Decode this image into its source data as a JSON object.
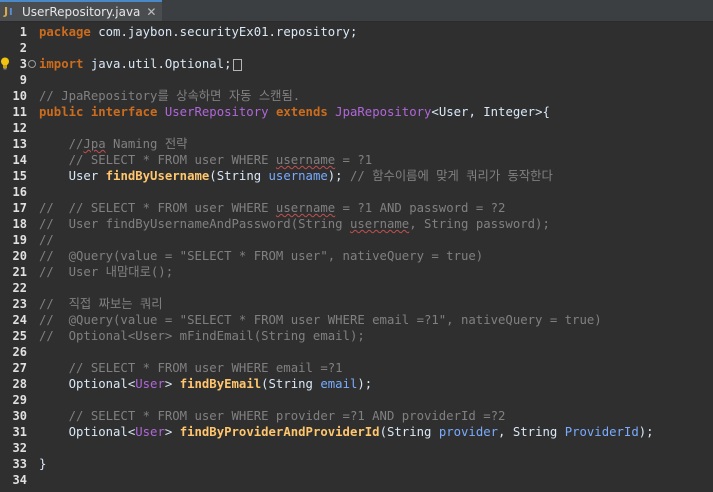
{
  "tab": {
    "filename": "UserRepository.java",
    "close_glyph": "✕"
  },
  "colors": {
    "background": "#2f2f2f",
    "keyword": "#cc6c1d",
    "type": "#b166da",
    "method": "#ffc66d",
    "parameter": "#79abff",
    "comment": "#808080",
    "plain": "#d9e8f7"
  },
  "lines": [
    {
      "n": "1",
      "segs": [
        {
          "c": "kw",
          "t": "package"
        },
        {
          "c": "pl",
          "t": " com.jaybon.securityEx01.repository;"
        }
      ]
    },
    {
      "n": "2",
      "segs": []
    },
    {
      "n": "3",
      "segs": [
        {
          "c": "kw",
          "t": "import"
        },
        {
          "c": "pl",
          "t": " java.util.Optional;"
        }
      ]
    },
    {
      "n": "9",
      "segs": []
    },
    {
      "n": "10",
      "segs": [
        {
          "c": "cm",
          "t": "// JpaRepository를 상속하면 자동 스캔됨."
        }
      ]
    },
    {
      "n": "11",
      "segs": [
        {
          "c": "kw",
          "t": "public"
        },
        {
          "c": "pl",
          "t": " "
        },
        {
          "c": "kw",
          "t": "interface"
        },
        {
          "c": "pl",
          "t": " "
        },
        {
          "c": "ty",
          "t": "UserRepository"
        },
        {
          "c": "pl",
          "t": " "
        },
        {
          "c": "kw",
          "t": "extends"
        },
        {
          "c": "pl",
          "t": " "
        },
        {
          "c": "ty",
          "t": "JpaRepository"
        },
        {
          "c": "pl",
          "t": "<User, Integer>{"
        }
      ]
    },
    {
      "n": "12",
      "segs": []
    },
    {
      "n": "13",
      "segs": [
        {
          "c": "cm",
          "t": "    //"
        },
        {
          "c": "cmw",
          "t": "Jpa"
        },
        {
          "c": "cm",
          "t": " Naming 전략"
        }
      ]
    },
    {
      "n": "14",
      "segs": [
        {
          "c": "cm",
          "t": "    // SELECT * FROM user WHERE "
        },
        {
          "c": "cmw",
          "t": "username"
        },
        {
          "c": "cm",
          "t": " = ?1"
        }
      ]
    },
    {
      "n": "15",
      "segs": [
        {
          "c": "pl",
          "t": "    User "
        },
        {
          "c": "fn",
          "t": "findByUsername"
        },
        {
          "c": "pl",
          "t": "(String "
        },
        {
          "c": "pa",
          "t": "username"
        },
        {
          "c": "pl",
          "t": "); "
        },
        {
          "c": "cm",
          "t": "// 함수이름에 맞게 쿼리가 동작한다"
        }
      ]
    },
    {
      "n": "16",
      "segs": []
    },
    {
      "n": "17",
      "segs": [
        {
          "c": "cm",
          "t": "//  // SELECT * FROM user WHERE "
        },
        {
          "c": "cmw",
          "t": "username"
        },
        {
          "c": "cm",
          "t": " = ?1 AND password = ?2"
        }
      ]
    },
    {
      "n": "18",
      "segs": [
        {
          "c": "cm",
          "t": "//  User findByUsernameAndPassword(String "
        },
        {
          "c": "cmw",
          "t": "username"
        },
        {
          "c": "cm",
          "t": ", String password);"
        }
      ]
    },
    {
      "n": "19",
      "segs": [
        {
          "c": "cm",
          "t": "//"
        }
      ]
    },
    {
      "n": "20",
      "segs": [
        {
          "c": "cm",
          "t": "//  @Query(value = \"SELECT * FROM user\", nativeQuery = true)"
        }
      ]
    },
    {
      "n": "21",
      "segs": [
        {
          "c": "cm",
          "t": "//  User 내맘대로();"
        }
      ]
    },
    {
      "n": "22",
      "segs": []
    },
    {
      "n": "23",
      "segs": [
        {
          "c": "cm",
          "t": "//  직접 짜보는 쿼리"
        }
      ]
    },
    {
      "n": "24",
      "segs": [
        {
          "c": "cm",
          "t": "//  @Query(value = \"SELECT * FROM user WHERE email =?1\", nativeQuery = true)"
        }
      ]
    },
    {
      "n": "25",
      "segs": [
        {
          "c": "cm",
          "t": "//  Optional<User> mFindEmail(String email);"
        }
      ]
    },
    {
      "n": "26",
      "segs": []
    },
    {
      "n": "27",
      "segs": [
        {
          "c": "cm",
          "t": "    // SELECT * FROM user WHERE email =?1"
        }
      ]
    },
    {
      "n": "28",
      "segs": [
        {
          "c": "pl",
          "t": "    Optional<"
        },
        {
          "c": "ty",
          "t": "User"
        },
        {
          "c": "pl",
          "t": "> "
        },
        {
          "c": "fn",
          "t": "findByEmail"
        },
        {
          "c": "pl",
          "t": "(String "
        },
        {
          "c": "pa",
          "t": "email"
        },
        {
          "c": "pl",
          "t": ");"
        }
      ]
    },
    {
      "n": "29",
      "segs": []
    },
    {
      "n": "30",
      "segs": [
        {
          "c": "cm",
          "t": "    // SELECT * FROM user WHERE provider =?1 AND providerId =?2"
        }
      ]
    },
    {
      "n": "31",
      "segs": [
        {
          "c": "pl",
          "t": "    Optional<"
        },
        {
          "c": "ty",
          "t": "User"
        },
        {
          "c": "pl",
          "t": "> "
        },
        {
          "c": "fn",
          "t": "findByProviderAndProviderId"
        },
        {
          "c": "pl",
          "t": "(String "
        },
        {
          "c": "pa",
          "t": "provider"
        },
        {
          "c": "pl",
          "t": ", String "
        },
        {
          "c": "pa",
          "t": "ProviderId"
        },
        {
          "c": "pl",
          "t": ");"
        }
      ]
    },
    {
      "n": "32",
      "segs": []
    },
    {
      "n": "33",
      "segs": [
        {
          "c": "pl",
          "t": "}"
        }
      ]
    },
    {
      "n": "34",
      "segs": []
    }
  ]
}
